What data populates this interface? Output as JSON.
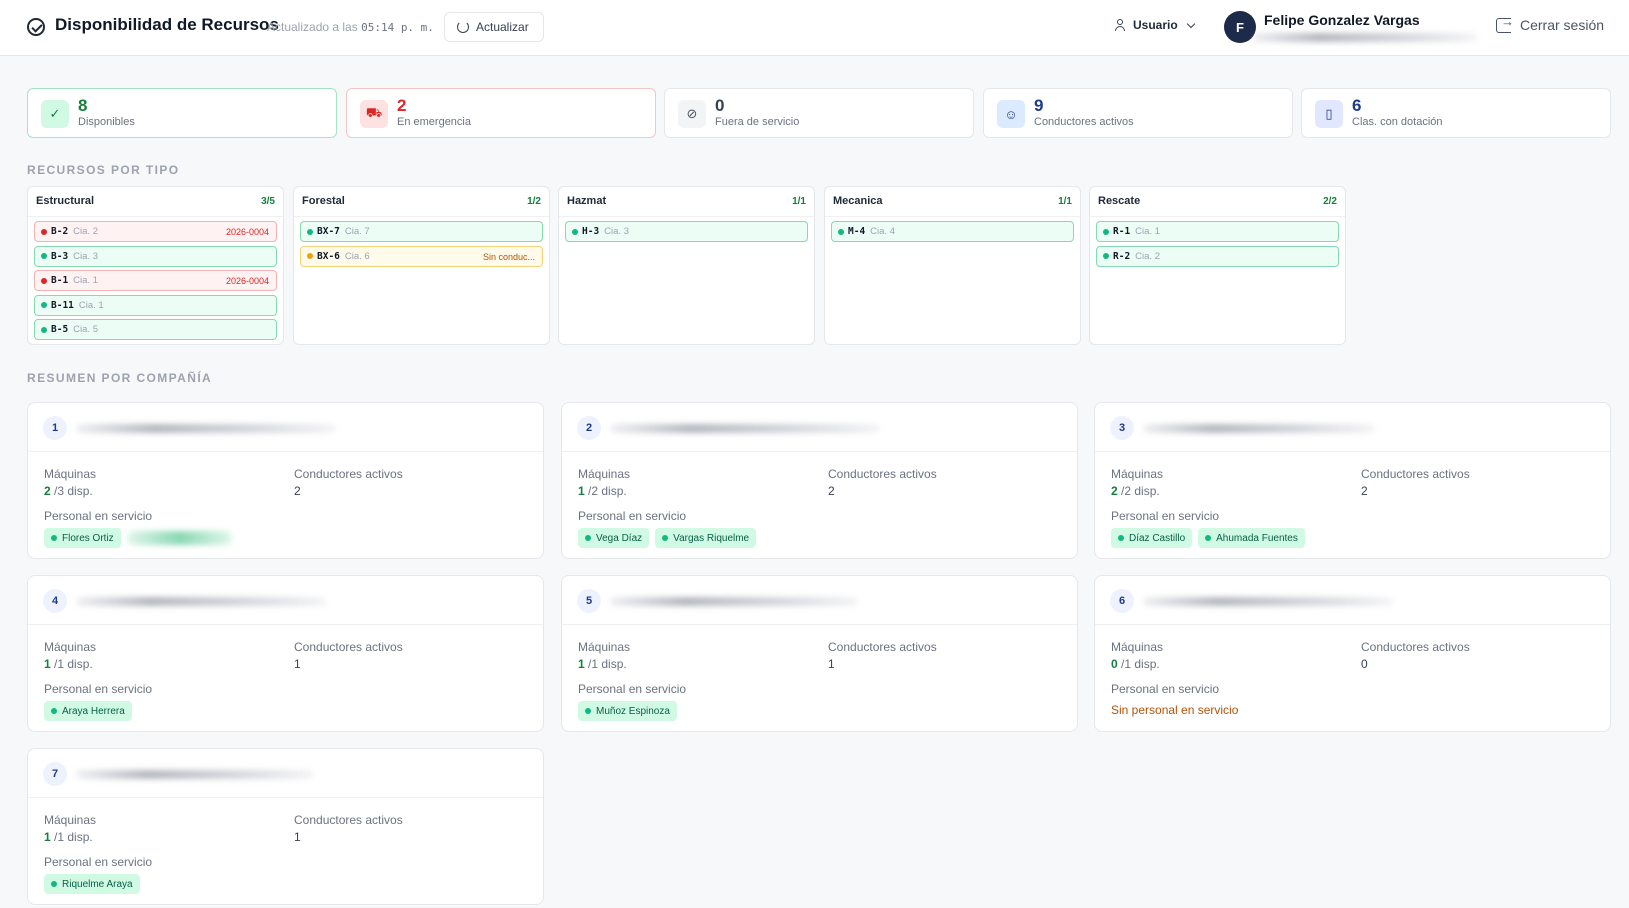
{
  "header": {
    "title": "Disponibilidad de Recursos",
    "updated_prefix": "Actualizado a las",
    "updated_time": "05:14 p. m.",
    "refresh_label": "Actualizar",
    "role_label": "Usuario",
    "avatar_initial": "F",
    "user_name": "Felipe Gonzalez Vargas",
    "logout_label": "Cerrar sesión"
  },
  "stats": [
    {
      "value": "8",
      "label": "Disponibles",
      "icon": "check-circle-icon",
      "color": "#15803d"
    },
    {
      "value": "2",
      "label": "En emergencia",
      "icon": "truck-icon",
      "color": "#dc2626"
    },
    {
      "value": "0",
      "label": "Fuera de servicio",
      "icon": "ban-icon",
      "color": "#374151"
    },
    {
      "value": "9",
      "label": "Conductores activos",
      "icon": "user-icon",
      "color": "#1e3a8a"
    },
    {
      "value": "6",
      "label": "Clas. con dotación",
      "icon": "building-icon",
      "color": "#1e3a8a"
    }
  ],
  "types_title": "RECURSOS POR TIPO",
  "types": [
    {
      "name": "Estructural",
      "count": "3/5",
      "items": [
        {
          "code": "B-2",
          "cia": "Cia. 2",
          "status": "emergency",
          "ref": "2026-0004"
        },
        {
          "code": "B-3",
          "cia": "Cia. 3",
          "status": "available",
          "ref": ""
        },
        {
          "code": "B-1",
          "cia": "Cia. 1",
          "status": "emergency",
          "ref": "2026-0004"
        },
        {
          "code": "B-11",
          "cia": "Cia. 1",
          "status": "available",
          "ref": ""
        },
        {
          "code": "B-5",
          "cia": "Cia. 5",
          "status": "available",
          "ref": ""
        }
      ]
    },
    {
      "name": "Forestal",
      "count": "1/2",
      "items": [
        {
          "code": "BX-7",
          "cia": "Cia. 7",
          "status": "available",
          "ref": ""
        },
        {
          "code": "BX-6",
          "cia": "Cia. 6",
          "status": "warning",
          "ref": "Sin conduc..."
        }
      ]
    },
    {
      "name": "Hazmat",
      "count": "1/1",
      "items": [
        {
          "code": "H-3",
          "cia": "Cia. 3",
          "status": "available",
          "ref": ""
        }
      ]
    },
    {
      "name": "Mecanica",
      "count": "1/1",
      "items": [
        {
          "code": "M-4",
          "cia": "Cia. 4",
          "status": "available",
          "ref": ""
        }
      ]
    },
    {
      "name": "Rescate",
      "count": "2/2",
      "items": [
        {
          "code": "R-1",
          "cia": "Cia. 1",
          "status": "available",
          "ref": ""
        },
        {
          "code": "R-2",
          "cia": "Cia. 2",
          "status": "available",
          "ref": ""
        }
      ]
    }
  ],
  "companies_title": "RESUMEN POR COMPAÑÍA",
  "labels": {
    "machines": "Máquinas",
    "drivers": "Conductores activos",
    "staff": "Personal en servicio",
    "no_staff": "Sin personal en servicio"
  },
  "companies": [
    {
      "num": "1",
      "avail": "2",
      "total": "/3 disp.",
      "drivers": "2",
      "staff": [
        "Flores Ortiz"
      ]
    },
    {
      "num": "2",
      "avail": "1",
      "total": "/2 disp.",
      "drivers": "2",
      "staff": [
        "Vega Díaz",
        "Vargas Riquelme"
      ]
    },
    {
      "num": "3",
      "avail": "2",
      "total": "/2 disp.",
      "drivers": "2",
      "staff": [
        "Díaz Castillo",
        "Ahumada Fuentes"
      ]
    },
    {
      "num": "4",
      "avail": "1",
      "total": "/1 disp.",
      "drivers": "1",
      "staff": [
        "Araya Herrera"
      ]
    },
    {
      "num": "5",
      "avail": "1",
      "total": "/1 disp.",
      "drivers": "1",
      "staff": [
        "Muñoz Espinoza"
      ]
    },
    {
      "num": "6",
      "avail": "0",
      "total": "/1 disp.",
      "drivers": "0",
      "staff": []
    },
    {
      "num": "7",
      "avail": "1",
      "total": "/1 disp.",
      "drivers": "1",
      "staff": [
        "Riquelme Araya"
      ]
    }
  ]
}
